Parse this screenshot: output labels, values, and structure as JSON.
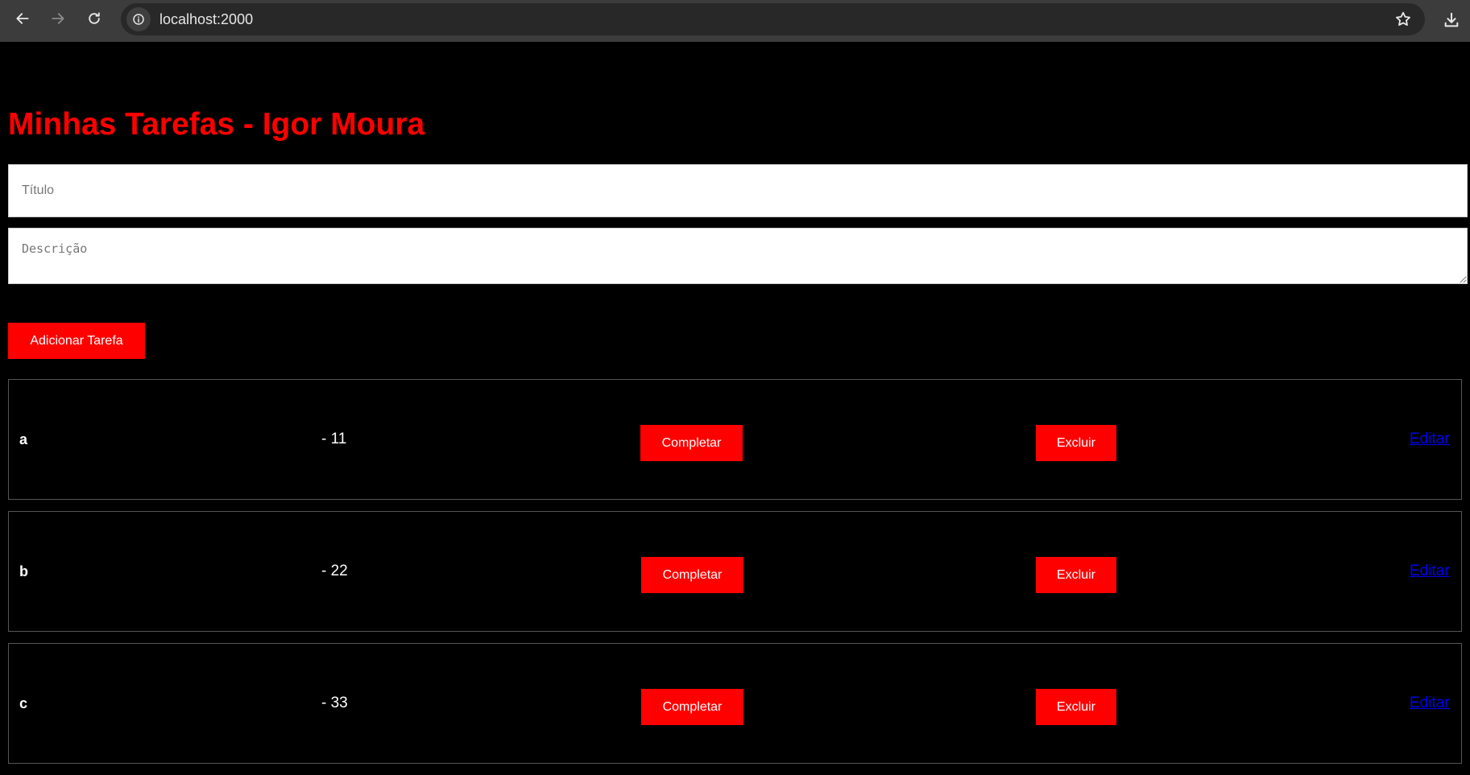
{
  "browser": {
    "url": "localhost:2000"
  },
  "page": {
    "title": "Minhas Tarefas - Igor Moura",
    "title_color": "#ff0000",
    "accent_color": "#ff0000",
    "form": {
      "title_placeholder": "Título",
      "title_value": "",
      "description_placeholder": "Descrição",
      "description_value": "",
      "add_button_label": "Adicionar Tarefa"
    },
    "tasks": [
      {
        "title": "a",
        "description": "- 11",
        "complete_label": "Completar",
        "delete_label": "Excluir",
        "edit_label": "Editar"
      },
      {
        "title": "b",
        "description": "- 22",
        "complete_label": "Completar",
        "delete_label": "Excluir",
        "edit_label": "Editar"
      },
      {
        "title": "c",
        "description": "- 33",
        "complete_label": "Completar",
        "delete_label": "Excluir",
        "edit_label": "Editar"
      }
    ]
  },
  "icons": {
    "back": "arrow-left-icon",
    "forward": "arrow-right-icon",
    "reload": "reload-icon",
    "site_info": "info-icon",
    "bookmark": "star-icon",
    "download": "download-icon"
  }
}
